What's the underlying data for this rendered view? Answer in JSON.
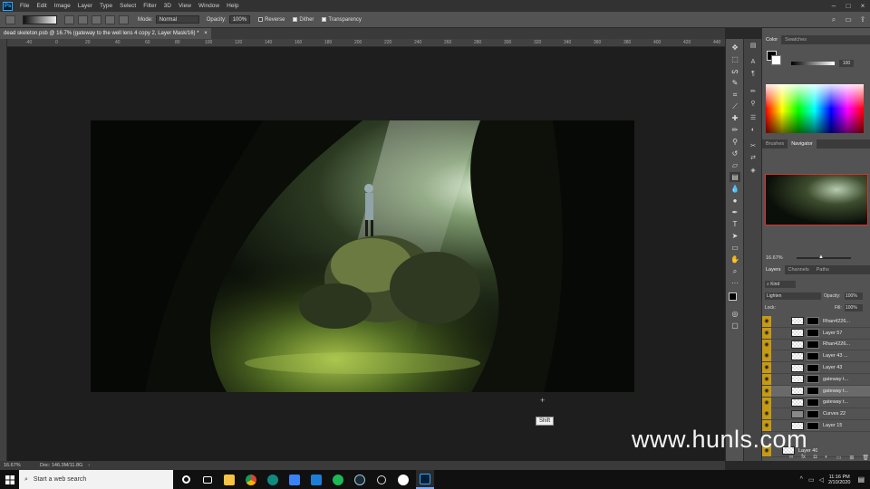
{
  "menu": [
    "File",
    "Edit",
    "Image",
    "Layer",
    "Type",
    "Select",
    "Filter",
    "3D",
    "View",
    "Window",
    "Help"
  ],
  "app_logo": "Ps",
  "options": {
    "mode_label": "Mode:",
    "mode_value": "Normal",
    "opacity_label": "Opacity:",
    "opacity_value": "100%",
    "reverse_label": "Reverse",
    "dither_label": "Dither",
    "transparency_label": "Transparency"
  },
  "document_tab": {
    "title": "dead skeleton.psb @ 16.7% (gateway to the well lens 4 copy 2, Layer Mask/16) *",
    "close": "×"
  },
  "ruler_ticks": [
    "-40",
    "0",
    "20",
    "40",
    "60",
    "80",
    "100",
    "120",
    "140",
    "160",
    "180",
    "200",
    "220",
    "240",
    "260",
    "280",
    "300",
    "320",
    "340",
    "360",
    "380",
    "400",
    "420",
    "440"
  ],
  "status": {
    "zoom": "16.67%",
    "doc": "Doc: 146.3M/11.8G"
  },
  "tooltip": "Shift",
  "color_panel": {
    "tabs": [
      "Color",
      "Swatches"
    ],
    "value": "100"
  },
  "navigator_panel": {
    "tabs": [
      "Brushes",
      "Navigator"
    ],
    "zoom": "16.67%"
  },
  "layers_panel": {
    "tabs": [
      "Layers",
      "Channels",
      "Paths"
    ],
    "filter": "Kind",
    "blend_mode": "Lighten",
    "opacity_label": "Opacity:",
    "opacity_value": "100%",
    "lock_label": "Lock:",
    "fill_label": "Fill:",
    "fill_value": "100%",
    "layers": [
      {
        "name": "Rhan4226..."
      },
      {
        "name": "Layer 57"
      },
      {
        "name": "Rhan4226..."
      },
      {
        "name": "Layer 43 ..."
      },
      {
        "name": "Layer 43"
      },
      {
        "name": "gateway t..."
      },
      {
        "name": "gateway t..."
      },
      {
        "name": "gateway t..."
      },
      {
        "name": "Curves 22"
      },
      {
        "name": "Layer 15"
      },
      {
        "name": "Layer 40"
      }
    ]
  },
  "taskbar": {
    "search_placeholder": "Start a web search",
    "time": "11:16 PM",
    "date": "2/10/2020"
  },
  "watermark": "www.hunls.com",
  "colors": {
    "accent_eye": "#c69a14",
    "ps_blue": "#31a8ff"
  }
}
